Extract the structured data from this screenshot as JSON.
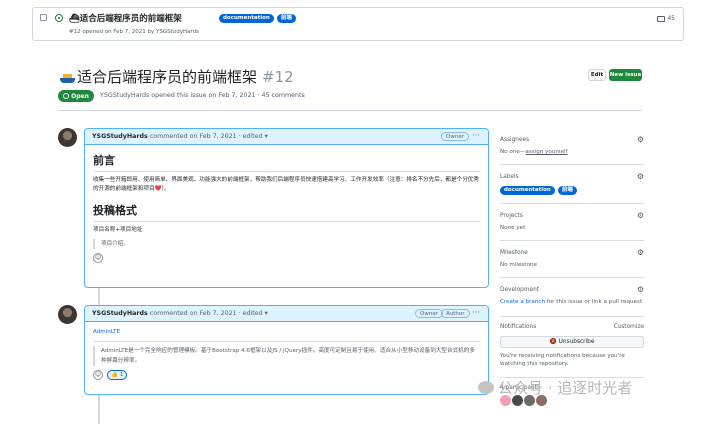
{
  "top_row": {
    "title": "⛴适合后端程序员的前端框架",
    "labels": [
      "documentation",
      "前端"
    ],
    "meta": "#12 opened on Feb 7, 2021 by YSGStudyHards",
    "comment_count": "45"
  },
  "header": {
    "title": "适合后端程序员的前端框架",
    "number": "#12",
    "edit_label": "Edit",
    "new_issue_label": "New issue",
    "state": "Open",
    "meta": "YSGStudyHards opened this issue on Feb 7, 2021 · 45 comments"
  },
  "comments": [
    {
      "author": "YSGStudyHards",
      "when": "commented on Feb 7, 2021 · edited",
      "role": "Owner",
      "heading1": "前言",
      "paragraph": "收集一些开箱即用、使用简单、界面美观、功能强大的前端框架，帮助我们后端程序员快速搭建高学习、工作开发效率（注意：排名不分先后，都是个分优秀的开源的前端框架和项目❤️）。",
      "heading2": "投稿格式",
      "format_line": "项目名称+项目地址",
      "format_quote": "项目介绍。",
      "reaction": "☺"
    },
    {
      "author": "YSGStudyHards",
      "when": "commented on Feb 7, 2021 · edited",
      "role": "Owner",
      "role2": "Author",
      "link": "AdminLTE",
      "quote": "AdminLTE是一个完全响应的管理模板。基于Bootstrap 4.6框架以及JS / jQuery插件。高度可定制且易于使用。适合从小型移动设备到大型台式机的多种屏幕分辨率。",
      "reaction": "☺",
      "reaction_pill": "👍 1"
    }
  ],
  "sidebar": {
    "assignees_label": "Assignees",
    "assignees_value": "No one—",
    "assign_yourself": "assign yourself",
    "labels_label": "Labels",
    "labels": [
      "documentation",
      "前端"
    ],
    "projects_label": "Projects",
    "projects_value": "None yet",
    "milestone_label": "Milestone",
    "milestone_value": "No milestone",
    "development_label": "Development",
    "development_link": "Create a branch",
    "development_rest": " for this issue or link a pull request.",
    "notifications_label": "Notifications",
    "customize_label": "Customize",
    "unsubscribe_label": "🔕 Unsubscribe",
    "notify_text": "You're receiving notifications because you're watching this repository.",
    "participants_label": "4 participants"
  },
  "watermark": "公众号 · 追逐时光者",
  "colors": {
    "accent": "#0969da",
    "open": "#1f883d",
    "label": "#0366d6",
    "comment_border": "#54aeff"
  }
}
